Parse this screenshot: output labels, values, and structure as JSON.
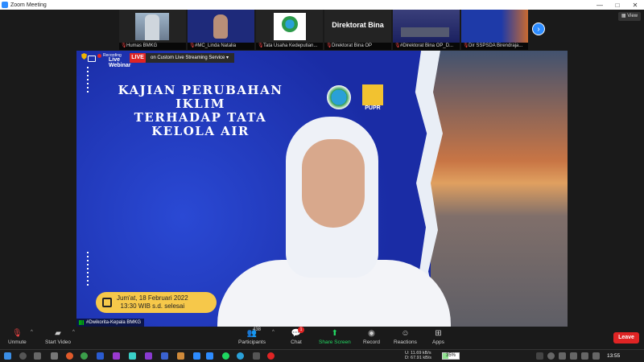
{
  "window": {
    "title": "Zoom Meeting",
    "controls": [
      "—",
      "□",
      "✕"
    ]
  },
  "view_button": {
    "label": "View"
  },
  "thumbnails": [
    {
      "name": "Humas BMKG",
      "image": "building",
      "muted": true
    },
    {
      "name": "#MC_Linda Natalia",
      "image": "person",
      "muted": true
    },
    {
      "name": "Tata Usaha Kedeputian...",
      "image": "bmkg-logo",
      "muted": true
    },
    {
      "name": "Direktorat Bina OP",
      "image": "text",
      "display_text": "Direktorat  Bina",
      "muted": true
    },
    {
      "name": "#Direktorat Bina OP_D...",
      "image": "room",
      "muted": true
    },
    {
      "name": "Dir SSPSDA Birendraja...",
      "image": "banner",
      "muted": true
    }
  ],
  "live_bar": {
    "recording_label": "Recording",
    "live_webinar_label": "Live\nWebinar",
    "live_badge": "LIVE",
    "stream_service": "on Custom Live Streaming Service"
  },
  "video": {
    "title_line1": "KAJIAN PERUBAHAN IKLIM",
    "title_line2": "TERHADAP TATA KELOLA AIR",
    "pupr_label": "PUPR",
    "date_line1": "Jum'at, 18 Februari 2022",
    "date_line2": "13:30 WIB s.d. selesai",
    "speaker_name": "#Dwikorita-Kepala BMKG"
  },
  "toolbar": {
    "unmute": "Unmute",
    "start_video": "Start Video",
    "participants": "Participants",
    "participants_count": "438",
    "chat": "Chat",
    "chat_badge": "1",
    "share_screen": "Share Screen",
    "record": "Record",
    "reactions": "Reactions",
    "apps": "Apps",
    "leave": "Leave"
  },
  "taskbar": {
    "upload_rate": "11.69 kB/s",
    "download_rate": "67.91 kB/s",
    "upload_label": "U:",
    "download_label": "D:",
    "battery": "35%",
    "clock": "13:55"
  },
  "colors": {
    "zoom_blue": "#2d8cff",
    "leave_red": "#e02424",
    "share_green": "#23d963",
    "banner_blue": "#1c33b8"
  }
}
